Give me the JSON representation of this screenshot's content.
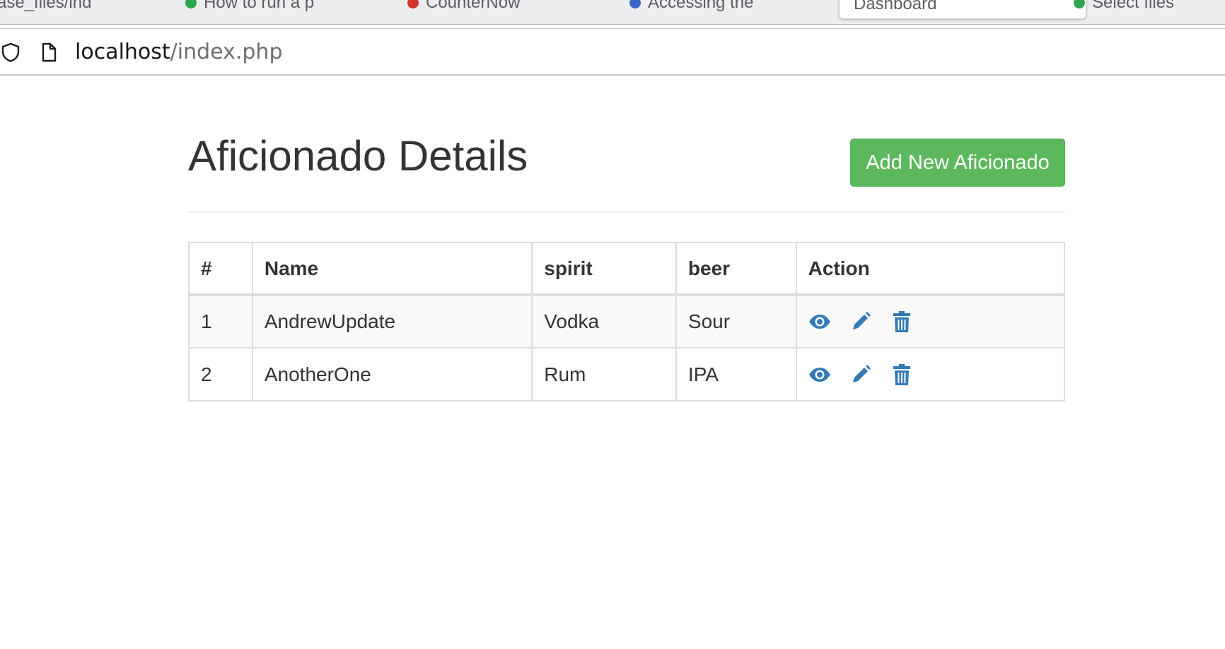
{
  "browser": {
    "tabs": [
      {
        "label": "ase_files/ind",
        "favicon": "none"
      },
      {
        "label": "How to run a p",
        "favicon": "globe-green"
      },
      {
        "label": "CounterNow",
        "favicon": "counter-red"
      },
      {
        "label": "Accessing the",
        "favicon": "globe-blue"
      },
      {
        "label": "Dashboard",
        "favicon": "none",
        "active": true
      },
      {
        "label": "Select files",
        "favicon": "globe-green"
      }
    ],
    "url": {
      "host": "localhost",
      "path": "/index.php"
    }
  },
  "page": {
    "title": "Aficionado Details",
    "add_button_label": "Add New Aficionado",
    "accent_color": "#5cb85c",
    "icon_color": "#337ab7"
  },
  "table": {
    "headers": {
      "num": "#",
      "name": "Name",
      "spirit": "spirit",
      "beer": "beer",
      "action": "Action"
    },
    "rows": [
      {
        "num": "1",
        "name": "AndrewUpdate",
        "spirit": "Vodka",
        "beer": "Sour",
        "actions": [
          "eye-icon",
          "pencil-icon",
          "trash-icon"
        ]
      },
      {
        "num": "2",
        "name": "AnotherOne",
        "spirit": "Rum",
        "beer": "IPA",
        "actions": [
          "eye-icon",
          "pencil-icon",
          "trash-icon"
        ]
      }
    ]
  }
}
